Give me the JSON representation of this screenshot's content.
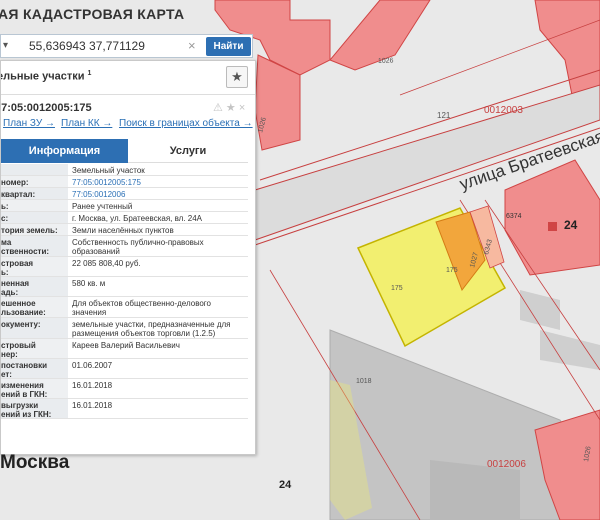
{
  "header": {
    "title": "АЯ КАДАСТРОВАЯ КАРТА"
  },
  "search": {
    "select_icon": "▾",
    "value": "55,636943 37,771129",
    "clear": "×",
    "button": "Найти"
  },
  "panel": {
    "title": "ельные участки",
    "title_sup": "1",
    "star": "★",
    "object_id": "77:05:0012005:175",
    "object_icons": "⚠ ★ ×",
    "links": [
      "План ЗУ →",
      "План КК →",
      "Поиск в границах объекта →"
    ],
    "tabs": [
      "Информация",
      "Услуги"
    ],
    "rows": [
      {
        "label": "",
        "value": "Земельный участок",
        "blue": false
      },
      {
        "label": "номер:",
        "value": "77:05:0012005:175",
        "blue": true
      },
      {
        "label": "квартал:",
        "value": "77:05:0012006",
        "blue": true
      },
      {
        "label": "ь:",
        "value": "Ранее учтенный",
        "blue": false
      },
      {
        "label": "с:",
        "value": "г. Москва, ул. Братеевская, вл. 24А",
        "blue": false
      },
      {
        "label": "тория земель:",
        "value": "Земли населённых пунктов",
        "blue": false
      },
      {
        "label": "ма\nственности:",
        "value": "Собственность публично-правовых образований",
        "blue": false
      },
      {
        "label": "стровая\nь:",
        "value": "22 085 808,40 руб.",
        "blue": false
      },
      {
        "label": "ненная\nадь:",
        "value": "580 кв. м",
        "blue": false
      },
      {
        "label": "ешенное\nльзование:",
        "value": "Для объектов общественно-делового значения",
        "blue": false
      },
      {
        "label": "окументу:",
        "value": "земельные участки, предназначенные для размещения объектов торговли (1.2.5)",
        "blue": false
      },
      {
        "label": "стровый\nнер:",
        "value": "Кареев Валерий Васильевич",
        "blue": false
      },
      {
        "label": "постановки\nет:",
        "value": "01.06.2007",
        "blue": false
      },
      {
        "label": "изменения\nений в ГКН:",
        "value": "16.01.2018",
        "blue": false
      },
      {
        "label": "выгрузки\nений из ГКН:",
        "value": "16.01.2018",
        "blue": false
      }
    ]
  },
  "map": {
    "street": "улица Братеевская",
    "labels": {
      "b1026": "1026",
      "q0012003": "0012003",
      "n121": "121",
      "n1026b": "1026",
      "n6374": "6374",
      "n24a": "24",
      "n175a": "175",
      "n175b": "175",
      "n1027": "1027",
      "n6343": "6343",
      "n1018": "1018",
      "n24b": "24",
      "q0012006": "0012006",
      "n1026c": "1026"
    },
    "city": "Москва"
  }
}
